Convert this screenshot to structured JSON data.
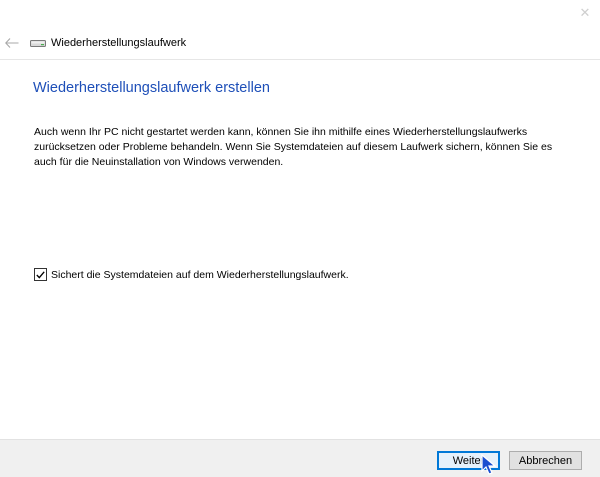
{
  "window": {
    "close_glyph": "✕"
  },
  "nav": {
    "back_icon": "back-arrow-icon",
    "drive_icon": "drive-icon",
    "title": "Wiederherstellungslaufwerk"
  },
  "content": {
    "heading": "Wiederherstellungslaufwerk erstellen",
    "description": "Auch wenn Ihr PC nicht gestartet werden kann, können Sie ihn mithilfe eines Wiederherstellungslaufwerks zurücksetzen oder Probleme behandeln. Wenn Sie Systemdateien auf diesem Laufwerk sichern, können Sie es auch für die Neuinstallation von Windows verwenden.",
    "checkbox": {
      "checked": true,
      "label": "Sichert die Systemdateien auf dem Wiederherstellungslaufwerk."
    }
  },
  "footer": {
    "next_label": "Weiter",
    "cancel_label": "Abbrechen"
  },
  "colors": {
    "heading": "#1e4fb8",
    "accent": "#0078d7",
    "footer_bg": "#f0f0f0"
  }
}
